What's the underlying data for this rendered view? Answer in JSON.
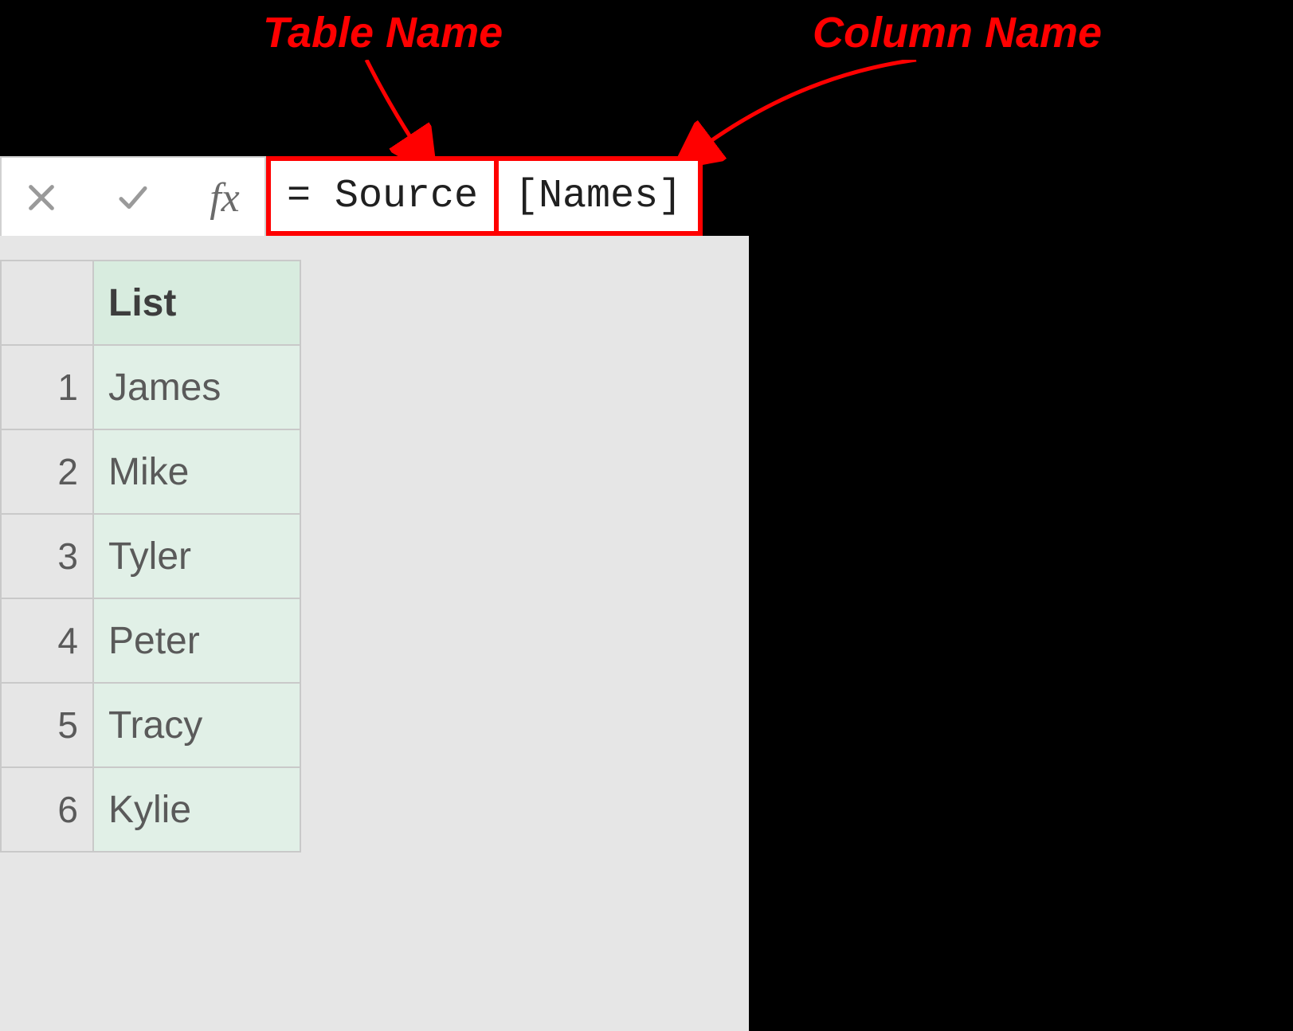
{
  "annotations": {
    "table_name_label": "Table Name",
    "column_name_label": "Column Name"
  },
  "formula_bar": {
    "equals": "= ",
    "table_ref": "Source",
    "column_ref": "[Names]"
  },
  "grid": {
    "column_header": "List",
    "rows": [
      {
        "n": "1",
        "value": "James"
      },
      {
        "n": "2",
        "value": "Mike"
      },
      {
        "n": "3",
        "value": "Tyler"
      },
      {
        "n": "4",
        "value": "Peter"
      },
      {
        "n": "5",
        "value": "Tracy"
      },
      {
        "n": "6",
        "value": "Kylie"
      }
    ]
  }
}
